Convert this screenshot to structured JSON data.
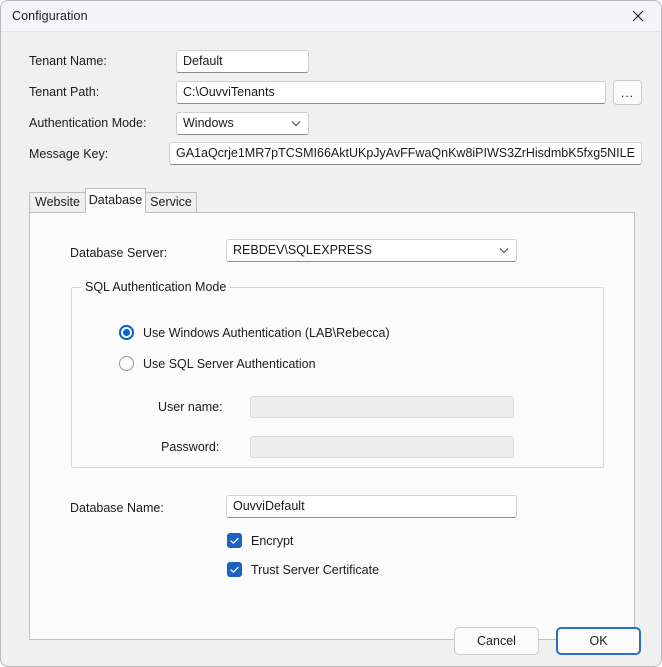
{
  "window": {
    "title": "Configuration",
    "close_icon": "close-icon",
    "accent_color": "#2a6fc9",
    "titlebar_color": "#f5f4f9",
    "body_color": "#f0f0f0"
  },
  "form": {
    "tenant_name": {
      "label": "Tenant Name:",
      "value": "Default"
    },
    "tenant_path": {
      "label": "Tenant Path:",
      "value": "C:\\OuvviTenants",
      "browse_label": "..."
    },
    "authentication_mode": {
      "label": "Authentication Mode:",
      "value": "Windows",
      "chevron_icon": "chevron-down-icon"
    },
    "message_key": {
      "label": "Message Key:",
      "value": "GA1aQcrje1MR7pTCSMI66AktUKpJyAvFFwaQnKw8iPIWS3ZrHisdmbK5fxg5NILE"
    }
  },
  "tabs": [
    {
      "label": "Website",
      "selected": false
    },
    {
      "label": "Database",
      "selected": true
    },
    {
      "label": "Service",
      "selected": false
    }
  ],
  "database_tab": {
    "database_server": {
      "label": "Database Server:",
      "value": "REBDEV\\SQLEXPRESS",
      "chevron_icon": "chevron-down-icon"
    },
    "sql_auth_group": {
      "title": "SQL Authentication Mode",
      "options": [
        {
          "label": "Use Windows Authentication (LAB\\Rebecca)",
          "checked": true
        },
        {
          "label": "Use SQL Server Authentication",
          "checked": false
        }
      ],
      "user_name": {
        "label": "User name:",
        "value": "",
        "disabled": true
      },
      "password": {
        "label": "Password:",
        "value": "",
        "disabled": true
      }
    },
    "database_name": {
      "label": "Database Name:",
      "value": "OuvviDefault"
    },
    "checkboxes": [
      {
        "label": "Encrypt",
        "checked": true
      },
      {
        "label": "Trust Server Certificate",
        "checked": true
      }
    ]
  },
  "footer": {
    "cancel_label": "Cancel",
    "ok_label": "OK"
  }
}
